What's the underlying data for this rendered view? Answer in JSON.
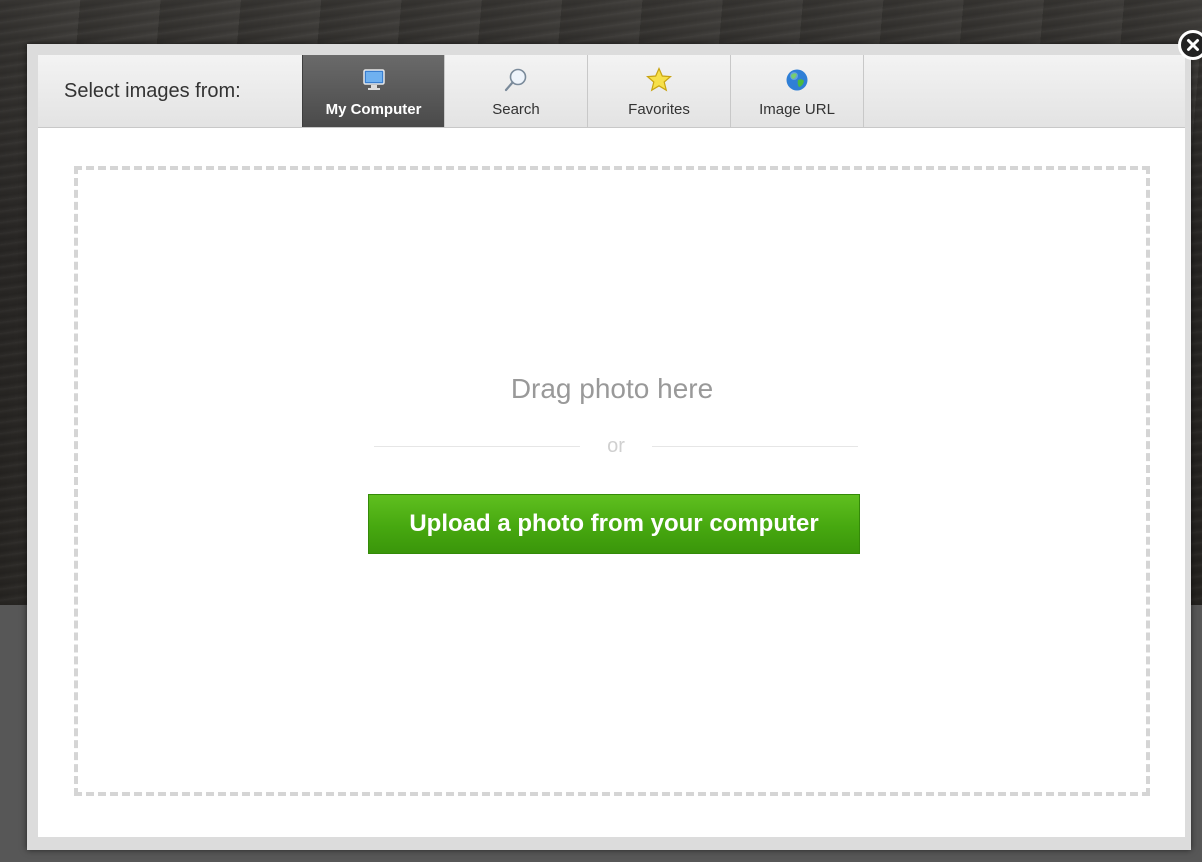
{
  "dialog": {
    "source_label": "Select images from:",
    "tabs": [
      {
        "label": "My Computer",
        "icon": "monitor-icon",
        "active": true
      },
      {
        "label": "Search",
        "icon": "magnifier-icon",
        "active": false
      },
      {
        "label": "Favorites",
        "icon": "star-icon",
        "active": false
      },
      {
        "label": "Image URL",
        "icon": "globe-icon",
        "active": false
      }
    ],
    "close_icon": "close-icon"
  },
  "dropzone": {
    "drag_text": "Drag photo here",
    "or_text": "or",
    "upload_button": "Upload a photo from your computer"
  },
  "colors": {
    "accent_green": "#47a810",
    "active_tab": "#555555",
    "dropzone_border": "#d5d5d5"
  }
}
